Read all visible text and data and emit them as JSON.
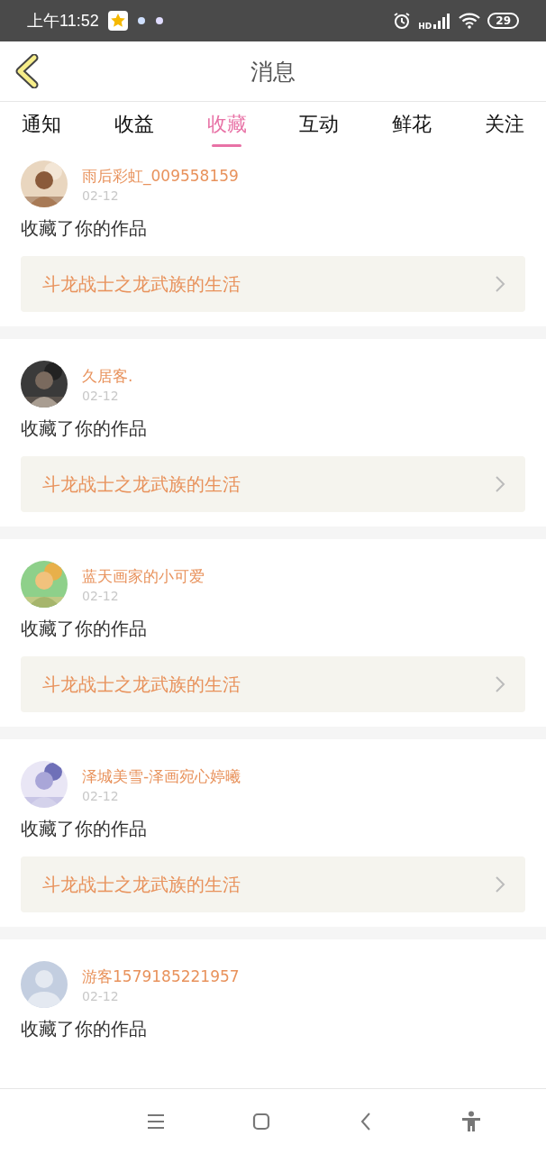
{
  "status_bar": {
    "time": "上午11:52",
    "network_label": "HD",
    "battery": "29"
  },
  "header": {
    "title": "消息"
  },
  "tabs": [
    {
      "label": "通知",
      "selected": false
    },
    {
      "label": "收益",
      "selected": false
    },
    {
      "label": "收藏",
      "selected": true
    },
    {
      "label": "互动",
      "selected": false
    },
    {
      "label": "鲜花",
      "selected": false
    },
    {
      "label": "关注",
      "selected": false
    }
  ],
  "messages": [
    {
      "name": "雨后彩虹_009558159",
      "date": "02-12",
      "text": "收藏了你的作品",
      "work": "斗龙战士之龙武族的生活"
    },
    {
      "name": "久居客.",
      "date": "02-12",
      "text": "收藏了你的作品",
      "work": "斗龙战士之龙武族的生活"
    },
    {
      "name": "蓝天画家的小可爱",
      "date": "02-12",
      "text": "收藏了你的作品",
      "work": "斗龙战士之龙武族的生活"
    },
    {
      "name": "泽城美雪-泽画宛心婷曦",
      "date": "02-12",
      "text": "收藏了你的作品",
      "work": "斗龙战士之龙武族的生活"
    },
    {
      "avatar": {
        "kind": "default"
      },
      "name": "游客1579185221957",
      "date": "02-12",
      "text": "收藏了你的作品"
    }
  ]
}
